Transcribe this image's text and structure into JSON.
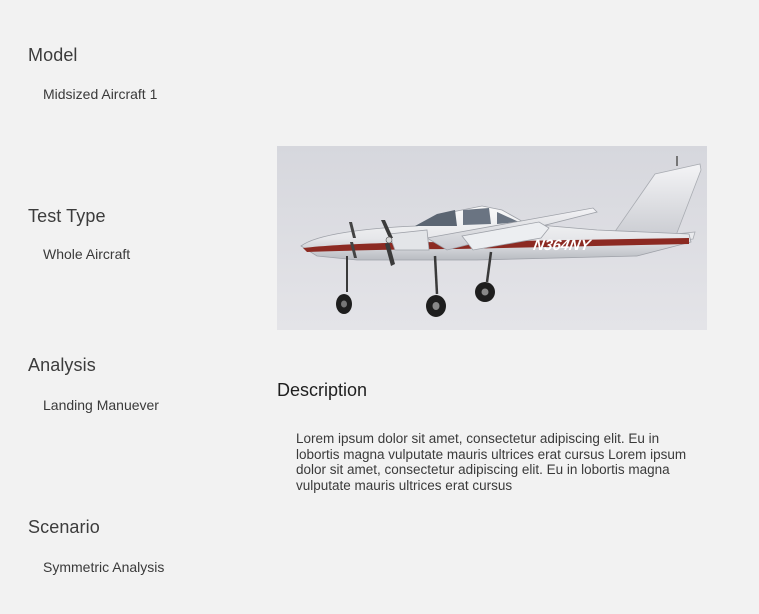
{
  "fields": {
    "model": {
      "label": "Model",
      "value": "Midsized Aircraft 1"
    },
    "test_type": {
      "label": "Test Type",
      "value": "Whole Aircraft"
    },
    "analysis": {
      "label": "Analysis",
      "value": "Landing Manuever"
    },
    "scenario": {
      "label": "Scenario",
      "value": "Symmetric Analysis"
    }
  },
  "image": {
    "registration": "N364NY",
    "icon": "twin-engine-aircraft-photo"
  },
  "description": {
    "heading": "Description",
    "body": "Lorem ipsum dolor sit amet, consectetur adipiscing elit. Eu in lobortis magna vulputate mauris ultrices erat cursus Lorem ipsum dolor sit amet, consectetur adipiscing elit. Eu in lobortis magna vulputate mauris ultrices erat cursus"
  },
  "colors": {
    "page_background": "#f2f2f2",
    "photo_sky": "#dcdde2",
    "aircraft_stripe": "#8c2a22"
  }
}
